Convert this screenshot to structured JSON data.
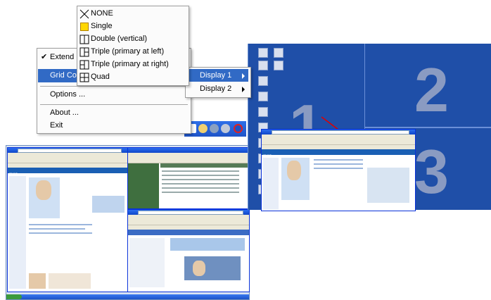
{
  "context_menu": {
    "items": [
      {
        "label": "Extend",
        "checked": true
      },
      {
        "label": "Grid Cor"
      },
      {
        "label": "Options ..."
      },
      {
        "label": "About ..."
      },
      {
        "label": "Exit"
      }
    ]
  },
  "display_submenu": {
    "items": [
      {
        "label": "Display 1"
      },
      {
        "label": "Display 2"
      }
    ]
  },
  "grid_submenu": {
    "items": [
      {
        "label": "NONE",
        "icon": "none-x-icon"
      },
      {
        "label": "Single",
        "icon": "grid-single-icon"
      },
      {
        "label": "Double (vertical)",
        "icon": "grid-double-vertical-icon"
      },
      {
        "label": "Triple (primary at left)",
        "icon": "grid-triple-left-icon"
      },
      {
        "label": "Triple (primary at right)",
        "icon": "grid-triple-right-icon"
      },
      {
        "label": "Quad",
        "icon": "grid-quad-icon"
      }
    ]
  },
  "desktop_zones": [
    "1",
    "2",
    "3"
  ],
  "colors": {
    "desktop_blue": "#1f4fa8",
    "menu_highlight": "#316ac5",
    "single_fill": "#ffd700",
    "arrow_red": "#e00000"
  }
}
